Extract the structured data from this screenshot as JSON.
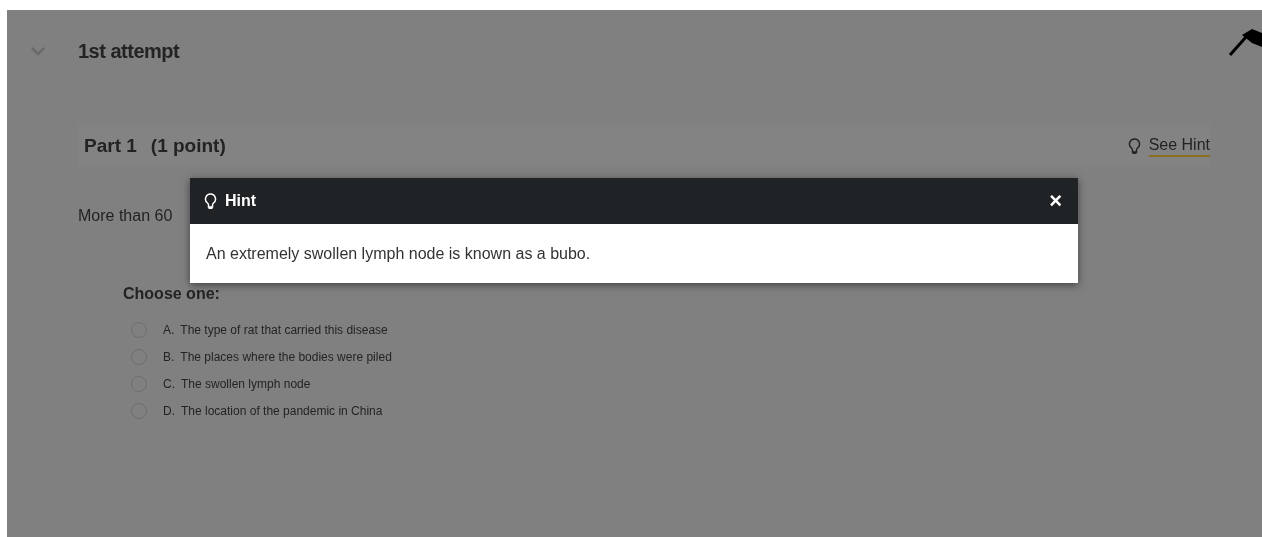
{
  "section": {
    "title": "1st attempt",
    "expanded": true
  },
  "part": {
    "title": "Part 1",
    "points": "(1 point)",
    "hint_link": "See Hint"
  },
  "question": {
    "text": "More than 60",
    "prompt": "Choose one:",
    "options": [
      {
        "letter": "A.",
        "text": "The type of rat that carried this disease",
        "selected": false
      },
      {
        "letter": "B.",
        "text": "The places where the bodies were piled",
        "selected": false
      },
      {
        "letter": "C.",
        "text": "The swollen lymph node",
        "selected": false
      },
      {
        "letter": "D.",
        "text": "The location of the pandemic in China",
        "selected": false
      }
    ]
  },
  "hint_dialog": {
    "title": "Hint",
    "close": "×",
    "body": "An extremely swollen lymph node is known as a bubo."
  }
}
